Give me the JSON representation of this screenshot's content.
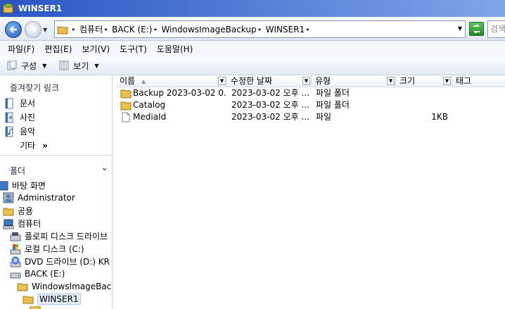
{
  "window": {
    "title": "WINSER1"
  },
  "address": {
    "crumbs": [
      "컴퓨터",
      "BACK (E:)",
      "WindowsImageBackup",
      "WINSER1"
    ],
    "search_placeholder": "검색"
  },
  "menu": [
    "파일(F)",
    "편집(E)",
    "보기(V)",
    "도구(T)",
    "도움말(H)"
  ],
  "toolbar": {
    "organize": "구성",
    "view": "보기"
  },
  "favorites": {
    "header": "즐겨찾기 링크",
    "items": [
      {
        "label": "문서",
        "icon": "documents-icon"
      },
      {
        "label": "사진",
        "icon": "pictures-icon"
      },
      {
        "label": "음악",
        "icon": "music-icon"
      }
    ],
    "more": "기타",
    "more_chevron": "»"
  },
  "folders": {
    "header": "폴더",
    "tree": [
      {
        "label": "바탕 화면",
        "icon": "desktop-icon"
      },
      {
        "label": "Administrator",
        "icon": "user-folder-icon"
      },
      {
        "label": "공용",
        "icon": "folder-icon"
      },
      {
        "label": "컴퓨터",
        "icon": "computer-icon"
      },
      {
        "label": "플로피 디스크 드라이브",
        "icon": "floppy-icon"
      },
      {
        "label": "로컬 디스크 (C:)",
        "icon": "local-disk-icon"
      },
      {
        "label": "DVD 드라이브 (D:) KR",
        "icon": "dvd-icon"
      },
      {
        "label": "BACK (E:)",
        "icon": "drive-icon"
      },
      {
        "label": "WindowsImageBack",
        "icon": "folder-icon"
      },
      {
        "label": "WINSER1",
        "icon": "folder-icon"
      }
    ]
  },
  "columns": [
    "이름",
    "수정한 날짜",
    "유형",
    "크기",
    "태그"
  ],
  "files": [
    {
      "name": "Backup 2023-03-02 0...",
      "date": "2023-03-02 오후 ...",
      "type": "파일 폴더",
      "size": "",
      "icon": "folder-icon"
    },
    {
      "name": "Catalog",
      "date": "2023-03-02 오후 ...",
      "type": "파일 폴더",
      "size": "",
      "icon": "folder-icon"
    },
    {
      "name": "MediaId",
      "date": "2023-03-02 오후 ...",
      "type": "파일",
      "size": "1KB",
      "icon": "file-icon"
    }
  ]
}
